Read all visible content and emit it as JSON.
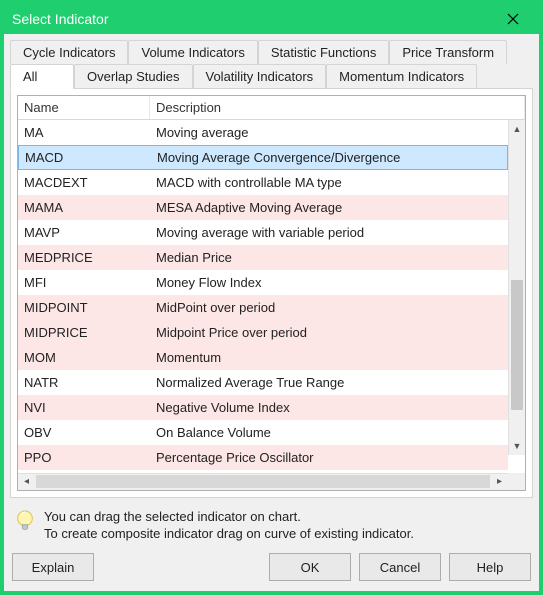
{
  "window": {
    "title": "Select Indicator"
  },
  "tabs_row1": [
    {
      "label": "Cycle Indicators"
    },
    {
      "label": "Volume Indicators"
    },
    {
      "label": "Statistic Functions"
    },
    {
      "label": "Price Transform"
    }
  ],
  "tabs_row2": [
    {
      "label": "All",
      "active": true
    },
    {
      "label": "Overlap Studies"
    },
    {
      "label": "Volatility Indicators"
    },
    {
      "label": "Momentum Indicators"
    }
  ],
  "columns": {
    "name": "Name",
    "desc": "Description"
  },
  "rows": [
    {
      "name": "MA",
      "desc": "Moving average",
      "pink": false,
      "selected": false
    },
    {
      "name": "MACD",
      "desc": "Moving Average Convergence/Divergence",
      "pink": false,
      "selected": true
    },
    {
      "name": "MACDEXT",
      "desc": "MACD with controllable MA type",
      "pink": false,
      "selected": false
    },
    {
      "name": "MAMA",
      "desc": "MESA Adaptive Moving Average",
      "pink": true,
      "selected": false
    },
    {
      "name": "MAVP",
      "desc": "Moving average with variable period",
      "pink": false,
      "selected": false
    },
    {
      "name": "MEDPRICE",
      "desc": "Median Price",
      "pink": true,
      "selected": false
    },
    {
      "name": "MFI",
      "desc": "Money Flow Index",
      "pink": false,
      "selected": false
    },
    {
      "name": "MIDPOINT",
      "desc": "MidPoint over period",
      "pink": true,
      "selected": false
    },
    {
      "name": "MIDPRICE",
      "desc": "Midpoint Price over period",
      "pink": true,
      "selected": false
    },
    {
      "name": "MOM",
      "desc": "Momentum",
      "pink": true,
      "selected": false
    },
    {
      "name": "NATR",
      "desc": "Normalized Average True Range",
      "pink": false,
      "selected": false
    },
    {
      "name": "NVI",
      "desc": "Negative Volume Index",
      "pink": true,
      "selected": false
    },
    {
      "name": "OBV",
      "desc": "On Balance Volume",
      "pink": false,
      "selected": false
    },
    {
      "name": "PPO",
      "desc": "Percentage Price Oscillator",
      "pink": true,
      "selected": false
    }
  ],
  "tip": {
    "line1": "You can drag the selected indicator on chart.",
    "line2": "To create composite indicator drag on curve of existing indicator."
  },
  "buttons": {
    "explain": "Explain",
    "ok": "OK",
    "cancel": "Cancel",
    "help": "Help"
  }
}
